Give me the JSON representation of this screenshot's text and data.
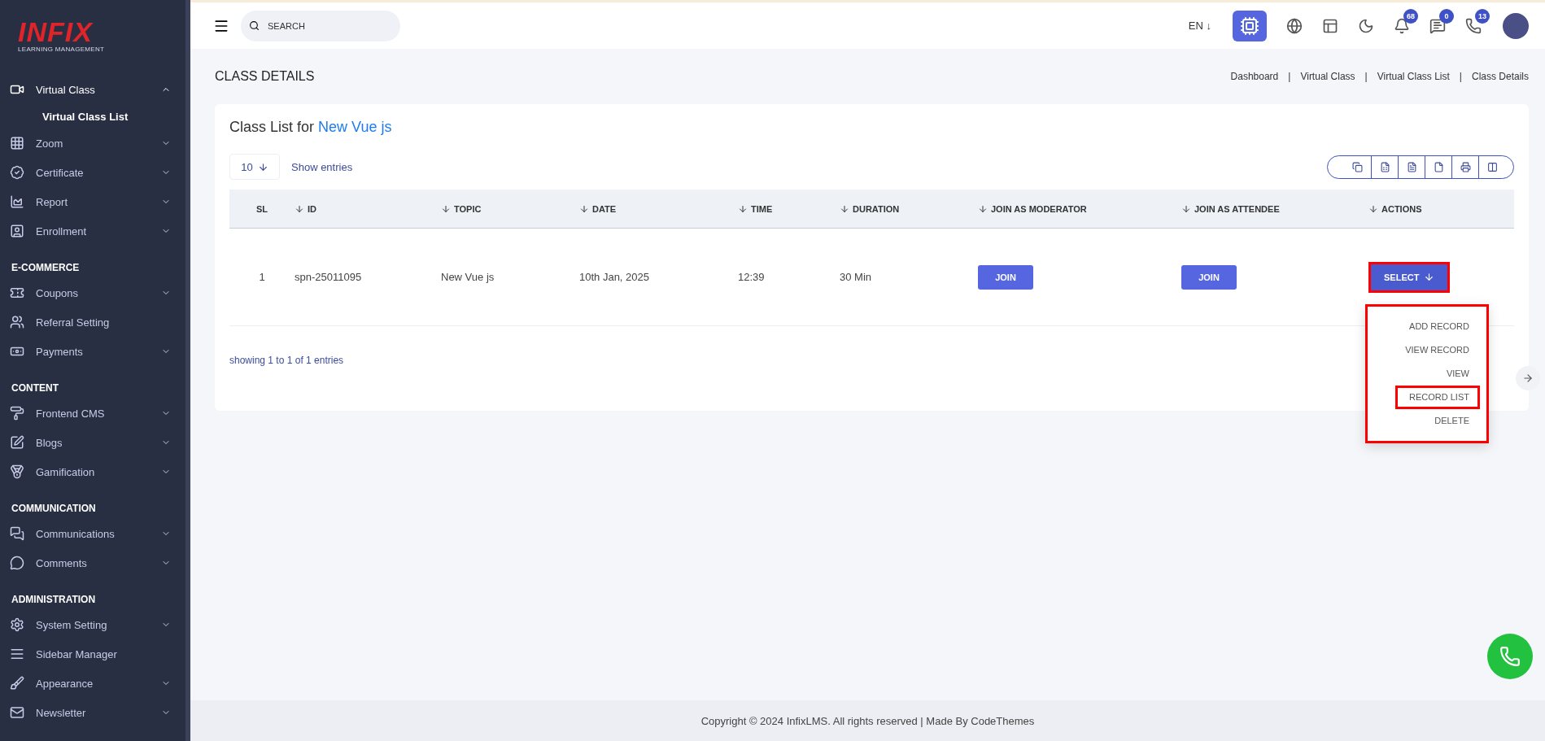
{
  "brand": {
    "name": "INFIX",
    "tagline": "LEARNING MANAGEMENT"
  },
  "sidebar": {
    "sections": [
      {
        "items": [
          {
            "label": "Virtual Class",
            "has_submenu": true,
            "expanded": true,
            "children": [
              {
                "label": "Virtual Class List",
                "selected": true
              }
            ]
          },
          {
            "label": "Zoom",
            "has_submenu": true,
            "expanded": false
          },
          {
            "label": "Certificate",
            "has_submenu": true,
            "expanded": false
          },
          {
            "label": "Report",
            "has_submenu": true,
            "expanded": false
          },
          {
            "label": "Enrollment",
            "has_submenu": true,
            "expanded": false
          }
        ]
      },
      {
        "title": "E-COMMERCE",
        "items": [
          {
            "label": "Coupons",
            "has_submenu": true,
            "expanded": false
          },
          {
            "label": "Referral Setting",
            "has_submenu": false,
            "expanded": false
          },
          {
            "label": "Payments",
            "has_submenu": true,
            "expanded": false
          }
        ]
      },
      {
        "title": "CONTENT",
        "items": [
          {
            "label": "Frontend CMS",
            "has_submenu": true,
            "expanded": false
          },
          {
            "label": "Blogs",
            "has_submenu": true,
            "expanded": false
          },
          {
            "label": "Gamification",
            "has_submenu": true,
            "expanded": false
          }
        ]
      },
      {
        "title": "COMMUNICATION",
        "items": [
          {
            "label": "Communications",
            "has_submenu": true,
            "expanded": false
          },
          {
            "label": "Comments",
            "has_submenu": true,
            "expanded": false
          }
        ]
      },
      {
        "title": "ADMINISTRATION",
        "items": [
          {
            "label": "System Setting",
            "has_submenu": true,
            "expanded": false
          },
          {
            "label": "Sidebar Manager",
            "has_submenu": false,
            "expanded": false
          },
          {
            "label": "Appearance",
            "has_submenu": true,
            "expanded": false
          },
          {
            "label": "Newsletter",
            "has_submenu": true,
            "expanded": false
          }
        ]
      }
    ]
  },
  "topbar": {
    "search": {
      "placeholder": "SEARCH"
    },
    "language": "EN ↓",
    "badges": [
      {
        "kind": "bell",
        "count": "68"
      },
      {
        "kind": "chat",
        "count": "0"
      },
      {
        "kind": "whatsapp",
        "count": "13"
      }
    ]
  },
  "page": {
    "title": "CLASS DETAILS",
    "breadcrumb": [
      {
        "label": "Dashboard"
      },
      {
        "label": "Virtual Class"
      },
      {
        "label": "Virtual Class List"
      },
      {
        "label": "Class Details"
      }
    ],
    "separator": "|"
  },
  "card": {
    "title_prefix": "Class List for",
    "title_link": "New Vue js",
    "page_size": "10",
    "show_entries": "Show entries",
    "columns": [
      {
        "label": "SL",
        "sortable": false
      },
      {
        "label": "ID",
        "sortable": true
      },
      {
        "label": "TOPIC",
        "sortable": true
      },
      {
        "label": "DATE",
        "sortable": true
      },
      {
        "label": "TIME",
        "sortable": true
      },
      {
        "label": "DURATION",
        "sortable": true
      },
      {
        "label": "JOIN AS MODERATOR",
        "sortable": true
      },
      {
        "label": "JOIN AS ATTENDEE",
        "sortable": true
      },
      {
        "label": "ACTIONS",
        "sortable": true
      }
    ],
    "rows": [
      {
        "sl": "1",
        "id": "spn-25011095",
        "topic": "New Vue js",
        "date": "10th Jan, 2025",
        "time": "12:39",
        "duration": "30 Min",
        "join_moderator": "JOIN",
        "join_attendee": "JOIN",
        "action": {
          "label": "SELECT",
          "highlighted": true,
          "expanded": true
        }
      }
    ],
    "menu": {
      "highlighted": true,
      "items": [
        {
          "label": "ADD RECORD",
          "highlighted": false
        },
        {
          "label": "VIEW RECORD",
          "highlighted": false
        },
        {
          "label": "VIEW",
          "highlighted": false
        },
        {
          "label": "RECORD LIST",
          "highlighted": true
        },
        {
          "label": "DELETE",
          "highlighted": false
        }
      ]
    },
    "summary": "showing 1 to 1 of 1 entries"
  },
  "footer": "Copyright © 2024 InfixLMS. All rights reserved | Made By CodeThemes"
}
